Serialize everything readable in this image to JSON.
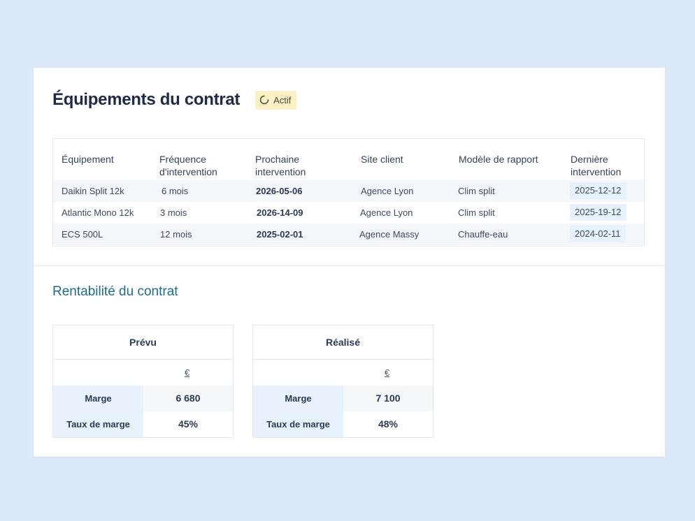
{
  "header": {
    "title": "Équipements du contrat",
    "status_label": "Actif",
    "status_icon": "loading-spinner-icon"
  },
  "equipment_table": {
    "columns": [
      [
        "Équipement",
        ""
      ],
      [
        "Fréquence",
        "d'intervention"
      ],
      [
        "Prochaine",
        "intervention"
      ],
      [
        "Site client",
        ""
      ],
      [
        "Modèle de rapport",
        ""
      ],
      [
        "Dernière",
        "intervention"
      ]
    ],
    "rows": [
      {
        "equipment": "Daikin Split 12k",
        "frequency": "6 mois",
        "next": "2026-05-06",
        "site": "Agence Lyon",
        "model": "Clim split",
        "last": "2025-12-12"
      },
      {
        "equipment": "Atlantic Mono 12k",
        "frequency": "3 mois",
        "next": "2026-14-09",
        "site": "Agence Lyon",
        "model": "Clim split",
        "last": "2025-19-12"
      },
      {
        "equipment": "ECS 500L",
        "frequency": "12 mois",
        "next": "2025-02-01",
        "site": "Agence Massy",
        "model": "Chauffe-eau",
        "last": "2024-02-11"
      }
    ]
  },
  "profitability": {
    "title": "Rentabilité du contrat",
    "tables": [
      {
        "heading": "Prévu",
        "currency": "€",
        "rows": [
          {
            "label": "Marge",
            "value": "6 680"
          },
          {
            "label": "Taux de marge",
            "value": "45%"
          }
        ]
      },
      {
        "heading": "Réalisé",
        "currency": "€",
        "rows": [
          {
            "label": "Marge",
            "value": "7 100"
          },
          {
            "label": "Taux de marge",
            "value": "48%"
          }
        ]
      }
    ]
  },
  "colors": {
    "background": "#dbe9f8",
    "badge_bg": "#fdf0c4",
    "accent_title": "#1c6c8c",
    "highlight": "#e8f2fd"
  }
}
